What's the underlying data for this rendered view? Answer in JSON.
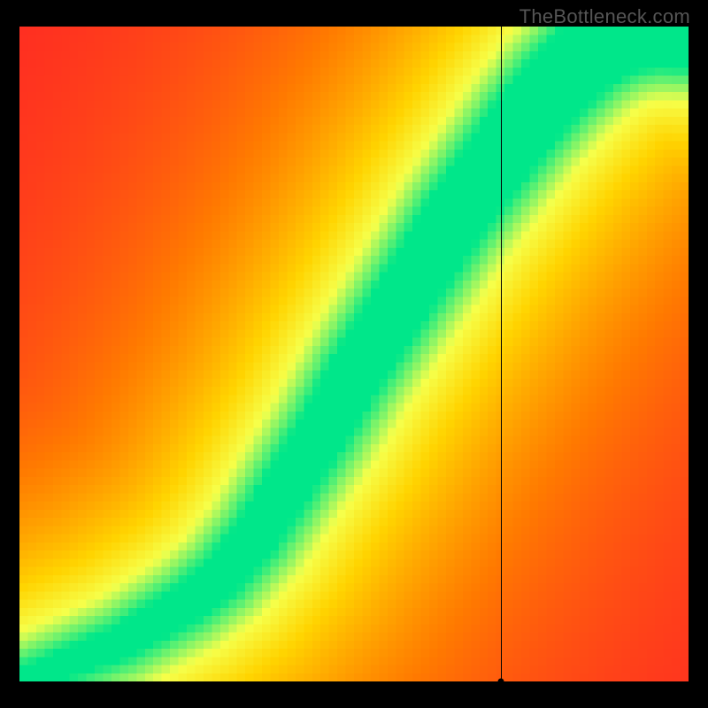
{
  "watermark": "TheBottleneck.com",
  "chart_data": {
    "type": "heatmap",
    "title": "",
    "xlabel": "",
    "ylabel": "",
    "xlim": [
      0,
      1
    ],
    "ylim": [
      0,
      1
    ],
    "grid": false,
    "legend": false,
    "colorscale": [
      "#ff1a2a",
      "#ff7a00",
      "#ffd400",
      "#f6ff4a",
      "#00e78a"
    ],
    "ridge": [
      {
        "x": 0.0,
        "y": 0.0
      },
      {
        "x": 0.05,
        "y": 0.02
      },
      {
        "x": 0.1,
        "y": 0.04
      },
      {
        "x": 0.15,
        "y": 0.06
      },
      {
        "x": 0.2,
        "y": 0.09
      },
      {
        "x": 0.25,
        "y": 0.12
      },
      {
        "x": 0.3,
        "y": 0.16
      },
      {
        "x": 0.35,
        "y": 0.22
      },
      {
        "x": 0.4,
        "y": 0.3
      },
      {
        "x": 0.45,
        "y": 0.38
      },
      {
        "x": 0.5,
        "y": 0.47
      },
      {
        "x": 0.55,
        "y": 0.55
      },
      {
        "x": 0.6,
        "y": 0.63
      },
      {
        "x": 0.65,
        "y": 0.71
      },
      {
        "x": 0.7,
        "y": 0.78
      },
      {
        "x": 0.75,
        "y": 0.85
      },
      {
        "x": 0.8,
        "y": 0.91
      },
      {
        "x": 0.85,
        "y": 0.96
      },
      {
        "x": 0.9,
        "y": 0.99
      },
      {
        "x": 0.95,
        "y": 1.0
      },
      {
        "x": 1.0,
        "y": 1.0
      }
    ],
    "marker": {
      "x": 0.72,
      "y": 0.0
    },
    "crosshair": {
      "x": 0.72,
      "y_top": 1.0,
      "y_bottom": 0.0
    },
    "grid_resolution": 80
  }
}
